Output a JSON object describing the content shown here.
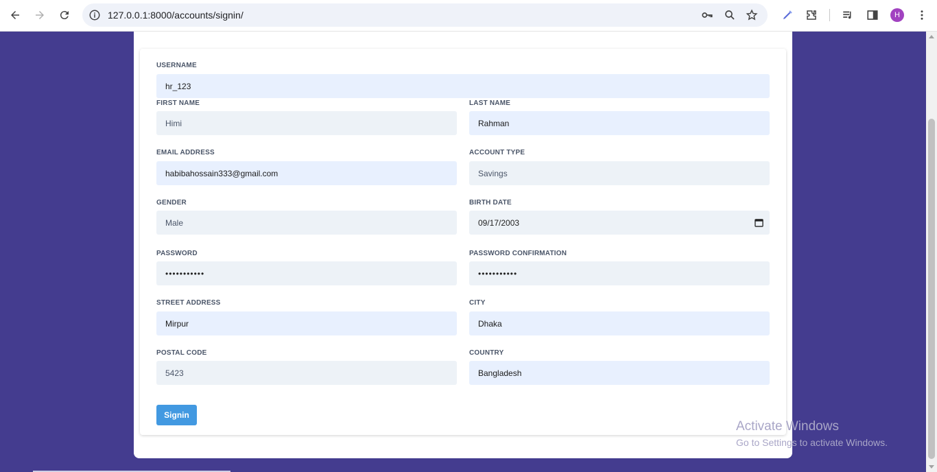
{
  "browser": {
    "url": "127.0.0.1:8000/accounts/signin/",
    "profile_initial": "H",
    "profile_color": "#a142c0"
  },
  "form": {
    "username": {
      "label": "USERNAME",
      "value": "hr_123"
    },
    "first_name": {
      "label": "FIRST NAME",
      "value": "Himi"
    },
    "last_name": {
      "label": "LAST NAME",
      "value": "Rahman"
    },
    "email": {
      "label": "EMAIL ADDRESS",
      "value": "habibahossain333@gmail.com"
    },
    "account_type": {
      "label": "ACCOUNT TYPE",
      "value": "Savings"
    },
    "gender": {
      "label": "GENDER",
      "value": "Male"
    },
    "birth_date": {
      "label": "BIRTH DATE",
      "value": "09/17/2003"
    },
    "password": {
      "label": "PASSWORD",
      "value": "•••••••••••"
    },
    "password_confirmation": {
      "label": "PASSWORD CONFIRMATION",
      "value": "•••••••••••"
    },
    "street_address": {
      "label": "STREET ADDRESS",
      "value": "Mirpur"
    },
    "city": {
      "label": "CITY",
      "value": "Dhaka"
    },
    "postal_code": {
      "label": "POSTAL CODE",
      "value": "5423"
    },
    "country": {
      "label": "COUNTRY",
      "value": "Bangladesh"
    },
    "submit_label": "Signin"
  },
  "watermark": {
    "title": "Activate Windows",
    "subtitle": "Go to Settings to activate Windows."
  },
  "colors": {
    "page_background": "#443c8f",
    "button": "#4299e1",
    "autofill": "#e8f0fe",
    "input": "#edf2f7"
  }
}
